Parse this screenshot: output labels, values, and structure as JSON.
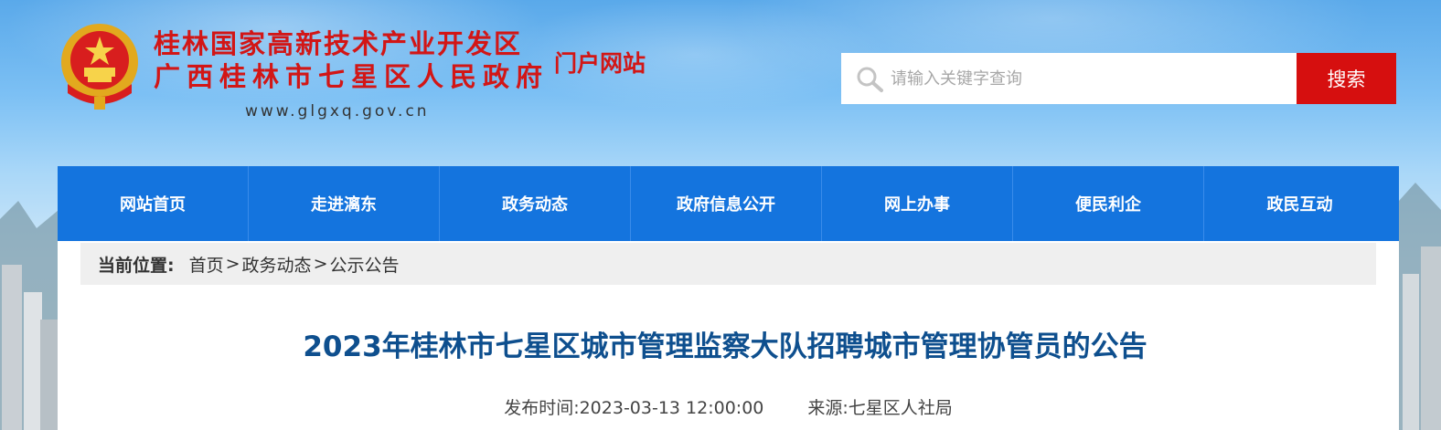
{
  "header": {
    "title_line1": "桂林国家高新技术产业开发区",
    "title_line2": "广西桂林市七星区人民政府",
    "portal_label": "门户网站",
    "url": "www.glgxq.gov.cn",
    "emblem_icon": "national-emblem-icon"
  },
  "search": {
    "placeholder": "请输入关键字查询",
    "value": "",
    "button_label": "搜索",
    "icon": "search-icon"
  },
  "nav": {
    "items": [
      {
        "label": "网站首页"
      },
      {
        "label": "走进漓东"
      },
      {
        "label": "政务动态"
      },
      {
        "label": "政府信息公开"
      },
      {
        "label": "网上办事"
      },
      {
        "label": "便民利企"
      },
      {
        "label": "政民互动"
      }
    ]
  },
  "breadcrumb": {
    "label": "当前位置:",
    "items": [
      "首页",
      "政务动态",
      "公示公告"
    ],
    "separator": ">"
  },
  "article": {
    "title": "2023年桂林市七星区城市管理监察大队招聘城市管理协管员的公告",
    "publish_label": "发布时间:",
    "publish_time": "2023-03-13 12:00:00",
    "source_label": "来源:",
    "source": "七星区人社局"
  },
  "colors": {
    "brand_red": "#d21616",
    "nav_blue": "#1474de",
    "title_blue": "#0e4f8e",
    "search_button": "#d60f0f"
  }
}
